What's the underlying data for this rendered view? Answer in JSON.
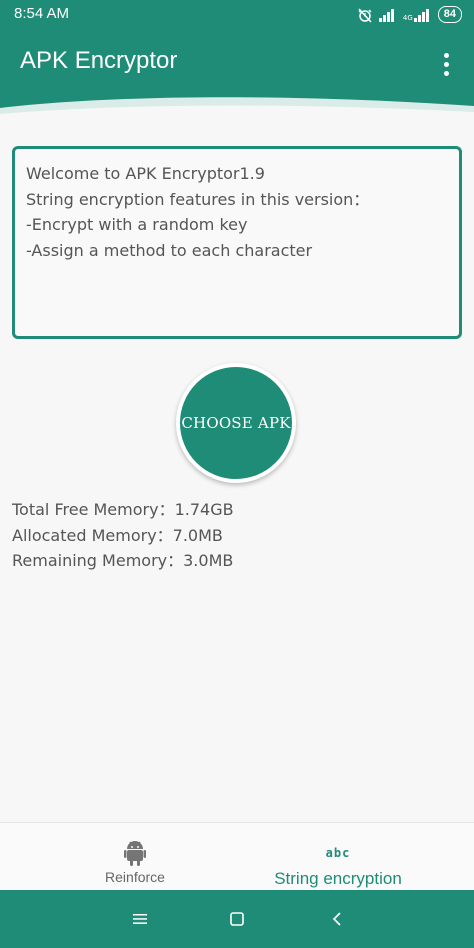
{
  "status_bar": {
    "time": "8:54 AM",
    "network_label": "4G",
    "battery": "84",
    "icons": [
      "alarm-off-icon",
      "signal-icon",
      "signal-4g-icon",
      "battery-icon"
    ]
  },
  "app_bar": {
    "title": "APK Encryptor",
    "menu_icon": "more-vert-icon"
  },
  "info_box": {
    "lines": [
      "Welcome to APK Encryptor1.9",
      "String encryption features in this version：",
      "-Encrypt with a random key",
      "-Assign a method to each character"
    ]
  },
  "choose_button": {
    "label": "CHOOSE APK"
  },
  "memory": {
    "lines": [
      "Total Free Memory：1.74GB",
      "Allocated Memory：7.0MB",
      "Remaining Memory：3.0MB"
    ]
  },
  "bottom_nav": {
    "items": [
      {
        "label": "Reinforce",
        "icon": "android-icon",
        "selected": false
      },
      {
        "label": "String encryption",
        "icon": "abc-icon",
        "icon_text": "abc",
        "selected": true
      }
    ]
  },
  "system_nav": {
    "icons": [
      "menu-icon",
      "home-icon",
      "back-icon"
    ]
  },
  "colors": {
    "primary": "#1e8c77",
    "text": "#555555",
    "background": "#f7f7f7"
  }
}
